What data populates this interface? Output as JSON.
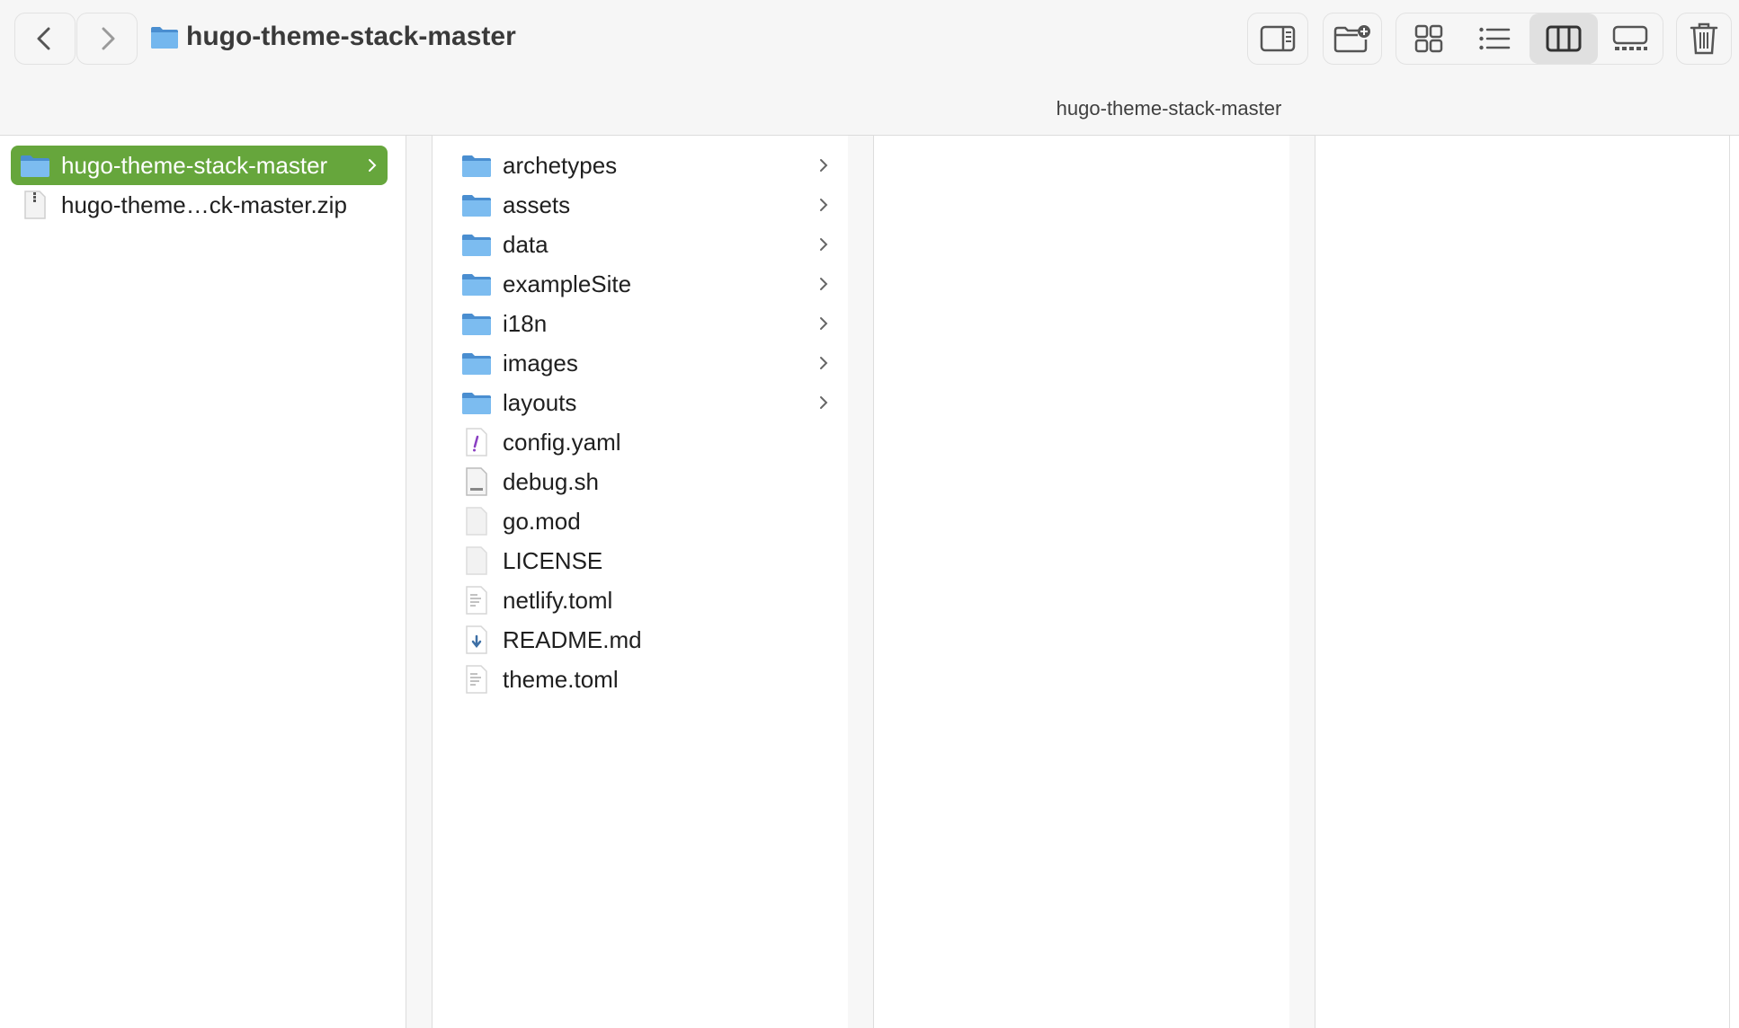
{
  "window": {
    "title": "hugo-theme-stack-master",
    "path_label": "hugo-theme-stack-master"
  },
  "toolbar": {
    "back_icon": "chevron-left-icon",
    "forward_icon": "chevron-right-icon",
    "buttons": [
      "sidebar-toggle-icon",
      "new-folder-icon",
      "grid-view-icon",
      "list-view-icon",
      "column-view-icon",
      "gallery-view-icon",
      "trash-icon"
    ],
    "active_view": "column-view"
  },
  "columns": [
    {
      "items": [
        {
          "label": "hugo-theme-stack-master",
          "type": "folder",
          "selected": true,
          "has_children": true
        },
        {
          "label": "hugo-theme…ck-master.zip",
          "type": "zip",
          "selected": false,
          "has_children": false
        }
      ]
    },
    {
      "items": [
        {
          "label": "archetypes",
          "type": "folder",
          "has_children": true
        },
        {
          "label": "assets",
          "type": "folder",
          "has_children": true
        },
        {
          "label": "data",
          "type": "folder",
          "has_children": true
        },
        {
          "label": "exampleSite",
          "type": "folder",
          "has_children": true
        },
        {
          "label": "i18n",
          "type": "folder",
          "has_children": true
        },
        {
          "label": "images",
          "type": "folder",
          "has_children": true
        },
        {
          "label": "layouts",
          "type": "folder",
          "has_children": true
        },
        {
          "label": "config.yaml",
          "type": "yaml",
          "has_children": false
        },
        {
          "label": "debug.sh",
          "type": "shell",
          "has_children": false
        },
        {
          "label": "go.mod",
          "type": "blank",
          "has_children": false
        },
        {
          "label": "LICENSE",
          "type": "blank",
          "has_children": false
        },
        {
          "label": "netlify.toml",
          "type": "text",
          "has_children": false
        },
        {
          "label": "README.md",
          "type": "markdown",
          "has_children": false
        },
        {
          "label": "theme.toml",
          "type": "text",
          "has_children": false
        }
      ]
    },
    {
      "items": []
    },
    {
      "items": []
    }
  ],
  "colors": {
    "selection": "#66a63c",
    "folder_blue": "#6fb3ea",
    "toolbar_bg": "#f6f6f6"
  }
}
